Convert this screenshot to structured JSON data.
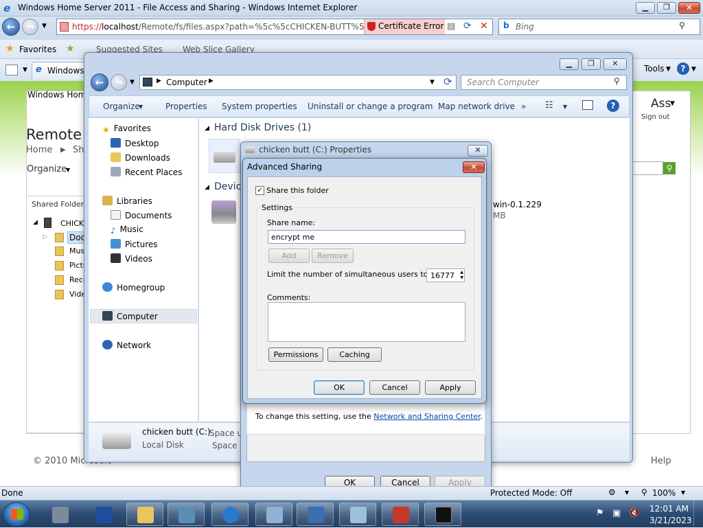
{
  "ie": {
    "title": "Windows Home Server 2011 - File Access and Sharing - Windows Internet Explorer",
    "url_prefix": "https://",
    "url_host": "localhost",
    "url_rest": "/Remote/fs/files.aspx?path=%5c%5cCHICKEN-BUTT%5cDo",
    "cert_error": "Certificate Error",
    "search_placeholder": "Bing",
    "favorites_label": "Favorites",
    "suggested_sites": "Suggested Sites",
    "web_slice": "Web Slice Gallery",
    "tab_label": "Windows",
    "tools_label": "Tools"
  },
  "web_page": {
    "logo": "Windows Home",
    "heading": "Remote W",
    "breadcrumb_home": "Home",
    "breadcrumb_next": "Sh",
    "organize": "Organize",
    "shared_folders": "Shared Folders",
    "tree": [
      "CHICKE",
      "Doc",
      "Mus",
      "Pictu",
      "Reco",
      "Vide"
    ],
    "user": "Ass",
    "sign_out": "Sign out",
    "footer": "© 2010 Microsoft",
    "help": "Help"
  },
  "explorer": {
    "breadcrumb": "Computer",
    "search_placeholder": "Search Computer",
    "toolbar": [
      "Organize",
      "Properties",
      "System properties",
      "Uninstall or change a program",
      "Map network drive",
      "»"
    ],
    "nav": {
      "favorites": "Favorites",
      "desktop": "Desktop",
      "downloads": "Downloads",
      "recent": "Recent Places",
      "libraries": "Libraries",
      "documents": "Documents",
      "music": "Music",
      "pictures": "Pictures",
      "videos": "Videos",
      "homegroup": "Homegroup",
      "computer": "Computer",
      "network": "Network"
    },
    "section_hdd": "Hard Disk Drives (1)",
    "section_devices": "Devic",
    "device_name": "win-0.1.229",
    "device_size": "MB",
    "details_name": "chicken butt (C:)",
    "details_type": "Local Disk",
    "details_space_used": "Space us",
    "details_space_free": "Space fr"
  },
  "properties": {
    "title": "chicken butt (C:) Properties",
    "info_text": "To change this setting, use the",
    "info_link": "Network and Sharing Center",
    "info_end": ".",
    "ok": "OK",
    "cancel": "Cancel",
    "apply": "Apply"
  },
  "advanced": {
    "title": "Advanced Sharing",
    "share_checkbox": "Share this folder",
    "settings_group": "Settings",
    "share_name_label": "Share name:",
    "share_name_value": "encrypt me",
    "add": "Add",
    "remove": "Remove",
    "limit_label": "Limit the number of simultaneous users to:",
    "limit_value": "16777",
    "comments_label": "Comments:",
    "permissions": "Permissions",
    "caching": "Caching",
    "ok": "OK",
    "cancel": "Cancel",
    "apply": "Apply"
  },
  "status": {
    "done": "Done",
    "protected": "Protected Mode: Off",
    "zoom": "100%"
  },
  "taskbar": {
    "time": "12:01 AM",
    "date": "3/21/2023"
  }
}
